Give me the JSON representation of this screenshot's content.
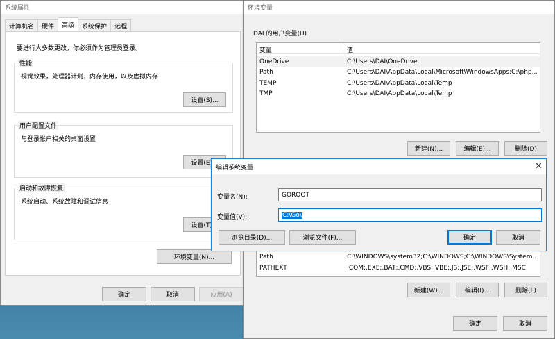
{
  "sys_props": {
    "title": "系统属性",
    "tabs": [
      "计算机名",
      "硬件",
      "高级",
      "系统保护",
      "远程"
    ],
    "admin_note": "要进行大多数更改，你必须作为管理员登录。",
    "performance": {
      "title": "性能",
      "desc": "视觉效果，处理器计划，内存使用，以及虚拟内存",
      "button": "设置(S)..."
    },
    "profile": {
      "title": "用户配置文件",
      "desc": "与登录帐户相关的桌面设置",
      "button": "设置(E)..."
    },
    "startup": {
      "title": "启动和故障恢复",
      "desc": "系统启动、系统故障和调试信息",
      "button": "设置(T)..."
    },
    "env_button": "环境变量(N)...",
    "ok": "确定",
    "cancel": "取消",
    "apply": "应用(A)"
  },
  "env_vars": {
    "title": "环境变量",
    "user_group": "DAI 的用户变量(U)",
    "col_var": "变量",
    "col_val": "值",
    "user_rows": [
      {
        "name": "OneDrive",
        "value": "C:\\Users\\DAI\\OneDrive"
      },
      {
        "name": "Path",
        "value": "C:\\Users\\DAI\\AppData\\Local\\Microsoft\\WindowsApps;C:\\php..."
      },
      {
        "name": "TEMP",
        "value": "C:\\Users\\DAI\\AppData\\Local\\Temp"
      },
      {
        "name": "TMP",
        "value": "C:\\Users\\DAI\\AppData\\Local\\Temp"
      }
    ],
    "user_new": "新建(N)...",
    "user_edit": "编辑(E)...",
    "user_delete": "删除(D)",
    "sys_rows": [
      {
        "name": "Path",
        "value": "C:\\WINDOWS\\system32;C:\\WINDOWS;C:\\WINDOWS\\System..."
      },
      {
        "name": "PATHEXT",
        "value": ".COM;.EXE;.BAT;.CMD;.VBS;.VBE;.JS;.JSE;.WSF;.WSH;.MSC"
      }
    ],
    "sys_new": "新建(W)...",
    "sys_edit": "编辑(I)...",
    "sys_delete": "删除(L)",
    "ok": "确定",
    "cancel": "取消"
  },
  "edit_dialog": {
    "title": "编辑系统变量",
    "name_label": "变量名(N):",
    "name_value": "GOROOT",
    "value_label": "变量值(V):",
    "value_value": "C:\\Go\\",
    "browse_dir": "浏览目录(D)...",
    "browse_file": "浏览文件(F)...",
    "ok": "确定",
    "cancel": "取消"
  }
}
